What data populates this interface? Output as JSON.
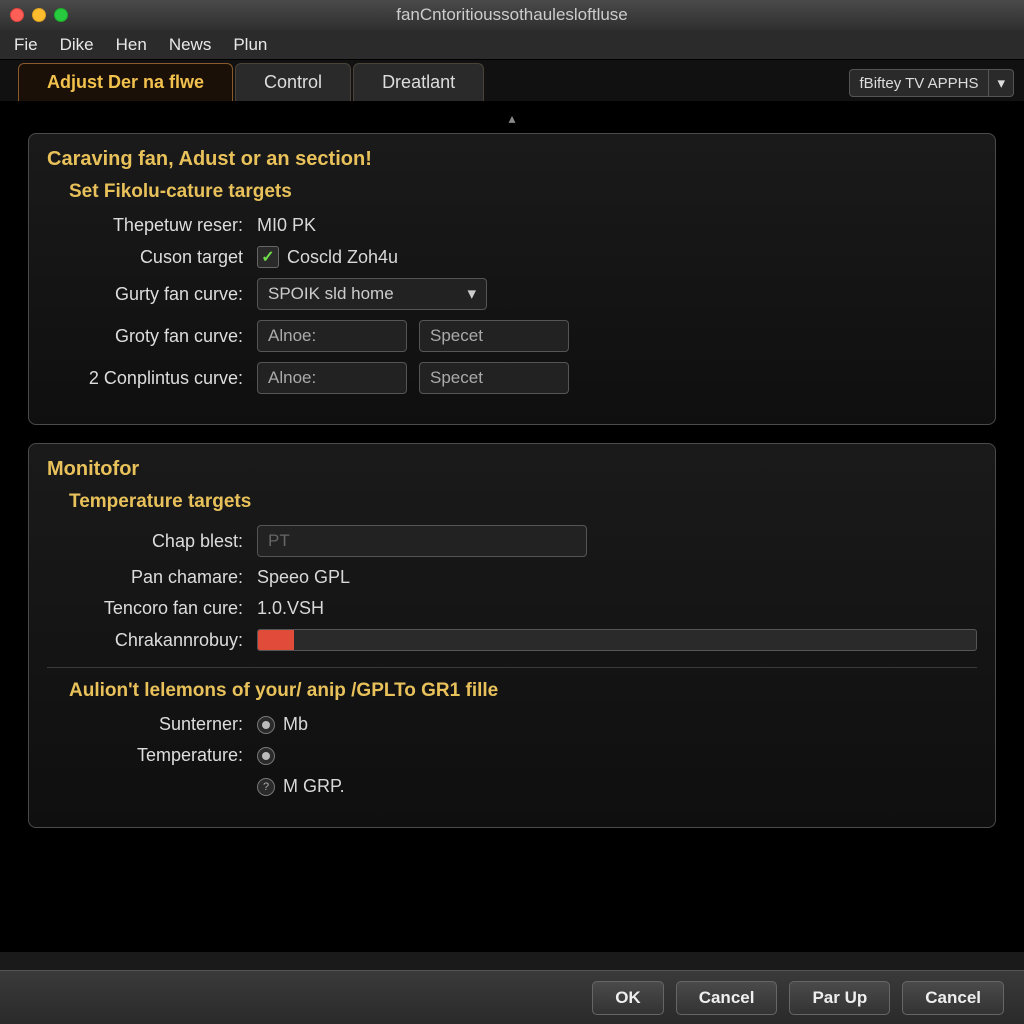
{
  "window": {
    "title": "fanCntoritioussothaulesloftluse"
  },
  "menubar": [
    "Fie",
    "Dike",
    "Hen",
    "News",
    "Plun"
  ],
  "tabs": [
    {
      "label": "Adjust Der na flwe",
      "active": true
    },
    {
      "label": "Control",
      "active": false
    },
    {
      "label": "Dreatlant",
      "active": false
    }
  ],
  "profile_dropdown": {
    "label": "fBiftey TV APPHS"
  },
  "panel1": {
    "title": "Caraving fan, Adust or an section!",
    "subtitle": "Set Fikolu-cature targets",
    "rows": {
      "thepetuw": {
        "label": "Thepetuw reser:",
        "value": "MI0 PK"
      },
      "cuson": {
        "label": "Cuson target",
        "checkbox_checked": true,
        "checkbox_label": "Coscld Zoh4u"
      },
      "gurty": {
        "label": "Gurty fan curve:",
        "select_value": "SPOIK sld home"
      },
      "groty": {
        "label": "Groty fan curve:",
        "input1": "Alnoe:",
        "input2": "Specet"
      },
      "conplintus": {
        "label": "2 Conplintus curve:",
        "input1": "Alnoe:",
        "input2": "Specet"
      }
    }
  },
  "panel2": {
    "title": "Monitofor",
    "subtitle": "Temperature targets",
    "rows": {
      "chap": {
        "label": "Chap blest:",
        "placeholder": "PT"
      },
      "pan": {
        "label": "Pan chamare:",
        "value": "Speeo GPL"
      },
      "tencoro": {
        "label": "Tencoro fan cure:",
        "value": "1.0.VSH"
      },
      "chrak": {
        "label": "Chrakannrobuy:",
        "progress_pct": 5
      }
    },
    "aulion": {
      "title": "Aulion't lelemons of your/ anip /GPLTo GR1 fille",
      "rows": {
        "sunterner": {
          "label": "Sunterner:",
          "value": "Mb",
          "selected": true
        },
        "temperature": {
          "label": "Temperature:",
          "value": "",
          "selected": true
        },
        "mgrp": {
          "label": "",
          "value": "M GRP.",
          "selected": false,
          "qmark": true
        }
      }
    }
  },
  "footer": {
    "ok": "OK",
    "cancel": "Cancel",
    "parup": "Par Up",
    "cancel2": "Cancel"
  },
  "colors": {
    "accent": "#e8c15a",
    "progress_fill": "#e04b3a"
  }
}
